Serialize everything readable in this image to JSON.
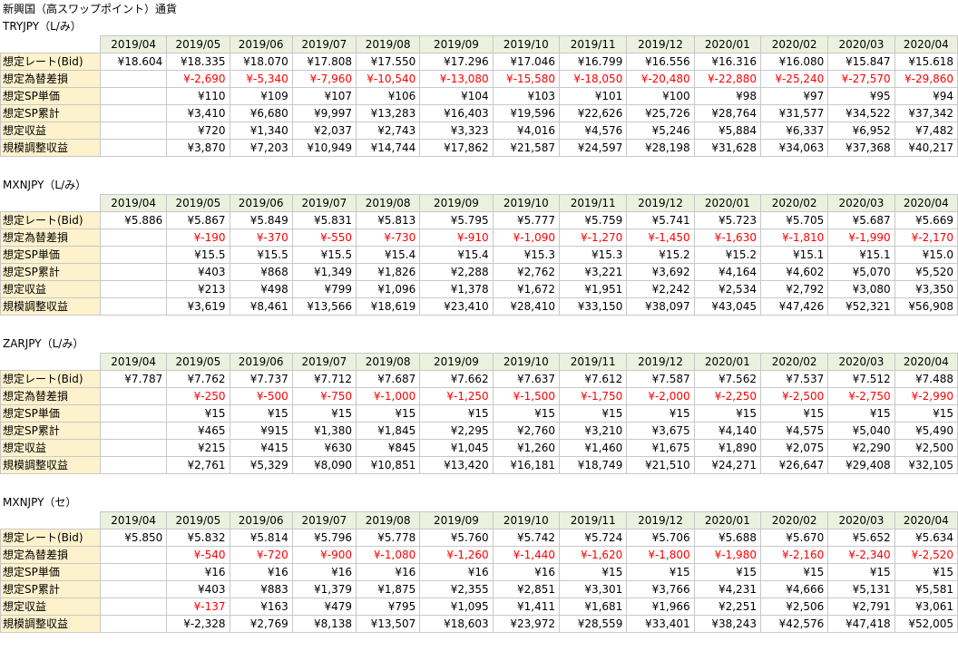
{
  "page_title": "新興国（高スワップポイント）通貨",
  "row_labels": [
    "想定レート(Bid)",
    "想定為替差損",
    "想定SP単価",
    "想定SP累計",
    "想定収益",
    "規模調整収益"
  ],
  "months": [
    "2019/04",
    "2019/05",
    "2019/06",
    "2019/07",
    "2019/08",
    "2019/09",
    "2019/10",
    "2019/11",
    "2019/12",
    "2020/01",
    "2020/02",
    "2020/03",
    "2020/04"
  ],
  "colors": {
    "header_bg": "#ebf1de",
    "label_bg": "#fdf2cc",
    "negative": "#ff0000",
    "grid": "#c8c8c8"
  },
  "sections": [
    {
      "title": "TRYJPY（L/み）",
      "rows": [
        [
          "¥18.604",
          "¥18.335",
          "¥18.070",
          "¥17.808",
          "¥17.550",
          "¥17.296",
          "¥17.046",
          "¥16.799",
          "¥16.556",
          "¥16.316",
          "¥16.080",
          "¥15.847",
          "¥15.618"
        ],
        [
          "",
          "¥-2,690",
          "¥-5,340",
          "¥-7,960",
          "¥-10,540",
          "¥-13,080",
          "¥-15,580",
          "¥-18,050",
          "¥-20,480",
          "¥-22,880",
          "¥-25,240",
          "¥-27,570",
          "¥-29,860"
        ],
        [
          "",
          "¥110",
          "¥109",
          "¥107",
          "¥106",
          "¥104",
          "¥103",
          "¥101",
          "¥100",
          "¥98",
          "¥97",
          "¥95",
          "¥94"
        ],
        [
          "",
          "¥3,410",
          "¥6,680",
          "¥9,997",
          "¥13,283",
          "¥16,403",
          "¥19,596",
          "¥22,626",
          "¥25,726",
          "¥28,764",
          "¥31,577",
          "¥34,522",
          "¥37,342"
        ],
        [
          "",
          "¥720",
          "¥1,340",
          "¥2,037",
          "¥2,743",
          "¥3,323",
          "¥4,016",
          "¥4,576",
          "¥5,246",
          "¥5,884",
          "¥6,337",
          "¥6,952",
          "¥7,482"
        ],
        [
          "",
          "¥3,870",
          "¥7,203",
          "¥10,949",
          "¥14,744",
          "¥17,862",
          "¥21,587",
          "¥24,597",
          "¥28,198",
          "¥31,628",
          "¥34,063",
          "¥37,368",
          "¥40,217"
        ]
      ]
    },
    {
      "title": "MXNJPY（L/み）",
      "rows": [
        [
          "¥5.886",
          "¥5.867",
          "¥5.849",
          "¥5.831",
          "¥5.813",
          "¥5.795",
          "¥5.777",
          "¥5.759",
          "¥5.741",
          "¥5.723",
          "¥5.705",
          "¥5.687",
          "¥5.669"
        ],
        [
          "",
          "¥-190",
          "¥-370",
          "¥-550",
          "¥-730",
          "¥-910",
          "¥-1,090",
          "¥-1,270",
          "¥-1,450",
          "¥-1,630",
          "¥-1,810",
          "¥-1,990",
          "¥-2,170"
        ],
        [
          "",
          "¥15.5",
          "¥15.5",
          "¥15.5",
          "¥15.4",
          "¥15.4",
          "¥15.3",
          "¥15.3",
          "¥15.2",
          "¥15.2",
          "¥15.1",
          "¥15.1",
          "¥15.0"
        ],
        [
          "",
          "¥403",
          "¥868",
          "¥1,349",
          "¥1,826",
          "¥2,288",
          "¥2,762",
          "¥3,221",
          "¥3,692",
          "¥4,164",
          "¥4,602",
          "¥5,070",
          "¥5,520"
        ],
        [
          "",
          "¥213",
          "¥498",
          "¥799",
          "¥1,096",
          "¥1,378",
          "¥1,672",
          "¥1,951",
          "¥2,242",
          "¥2,534",
          "¥2,792",
          "¥3,080",
          "¥3,350"
        ],
        [
          "",
          "¥3,619",
          "¥8,461",
          "¥13,566",
          "¥18,619",
          "¥23,410",
          "¥28,410",
          "¥33,150",
          "¥38,097",
          "¥43,045",
          "¥47,426",
          "¥52,321",
          "¥56,908"
        ]
      ]
    },
    {
      "title": "ZARJPY（L/み）",
      "rows": [
        [
          "¥7.787",
          "¥7.762",
          "¥7.737",
          "¥7.712",
          "¥7.687",
          "¥7.662",
          "¥7.637",
          "¥7.612",
          "¥7.587",
          "¥7.562",
          "¥7.537",
          "¥7.512",
          "¥7.488"
        ],
        [
          "",
          "¥-250",
          "¥-500",
          "¥-750",
          "¥-1,000",
          "¥-1,250",
          "¥-1,500",
          "¥-1,750",
          "¥-2,000",
          "¥-2,250",
          "¥-2,500",
          "¥-2,750",
          "¥-2,990"
        ],
        [
          "",
          "¥15",
          "¥15",
          "¥15",
          "¥15",
          "¥15",
          "¥15",
          "¥15",
          "¥15",
          "¥15",
          "¥15",
          "¥15",
          "¥15"
        ],
        [
          "",
          "¥465",
          "¥915",
          "¥1,380",
          "¥1,845",
          "¥2,295",
          "¥2,760",
          "¥3,210",
          "¥3,675",
          "¥4,140",
          "¥4,575",
          "¥5,040",
          "¥5,490"
        ],
        [
          "",
          "¥215",
          "¥415",
          "¥630",
          "¥845",
          "¥1,045",
          "¥1,260",
          "¥1,460",
          "¥1,675",
          "¥1,890",
          "¥2,075",
          "¥2,290",
          "¥2,500"
        ],
        [
          "",
          "¥2,761",
          "¥5,329",
          "¥8,090",
          "¥10,851",
          "¥13,420",
          "¥16,181",
          "¥18,749",
          "¥21,510",
          "¥24,271",
          "¥26,647",
          "¥29,408",
          "¥32,105"
        ]
      ]
    },
    {
      "title": "MXNJPY（セ）",
      "rows": [
        [
          "¥5.850",
          "¥5.832",
          "¥5.814",
          "¥5.796",
          "¥5.778",
          "¥5.760",
          "¥5.742",
          "¥5.724",
          "¥5.706",
          "¥5.688",
          "¥5.670",
          "¥5.652",
          "¥5.634"
        ],
        [
          "",
          "¥-540",
          "¥-720",
          "¥-900",
          "¥-1,080",
          "¥-1,260",
          "¥-1,440",
          "¥-1,620",
          "¥-1,800",
          "¥-1,980",
          "¥-2,160",
          "¥-2,340",
          "¥-2,520"
        ],
        [
          "",
          "¥16",
          "¥16",
          "¥16",
          "¥16",
          "¥16",
          "¥16",
          "¥15",
          "¥15",
          "¥15",
          "¥15",
          "¥15",
          "¥15"
        ],
        [
          "",
          "¥403",
          "¥883",
          "¥1,379",
          "¥1,875",
          "¥2,355",
          "¥2,851",
          "¥3,301",
          "¥3,766",
          "¥4,231",
          "¥4,666",
          "¥5,131",
          "¥5,581"
        ],
        [
          "",
          "¥-137",
          "¥163",
          "¥479",
          "¥795",
          "¥1,095",
          "¥1,411",
          "¥1,681",
          "¥1,966",
          "¥2,251",
          "¥2,506",
          "¥2,791",
          "¥3,061"
        ],
        [
          "",
          "¥-2,328",
          "¥2,769",
          "¥8,138",
          "¥13,507",
          "¥18,603",
          "¥23,972",
          "¥28,559",
          "¥33,401",
          "¥38,243",
          "¥42,576",
          "¥47,418",
          "¥52,005"
        ]
      ]
    }
  ]
}
